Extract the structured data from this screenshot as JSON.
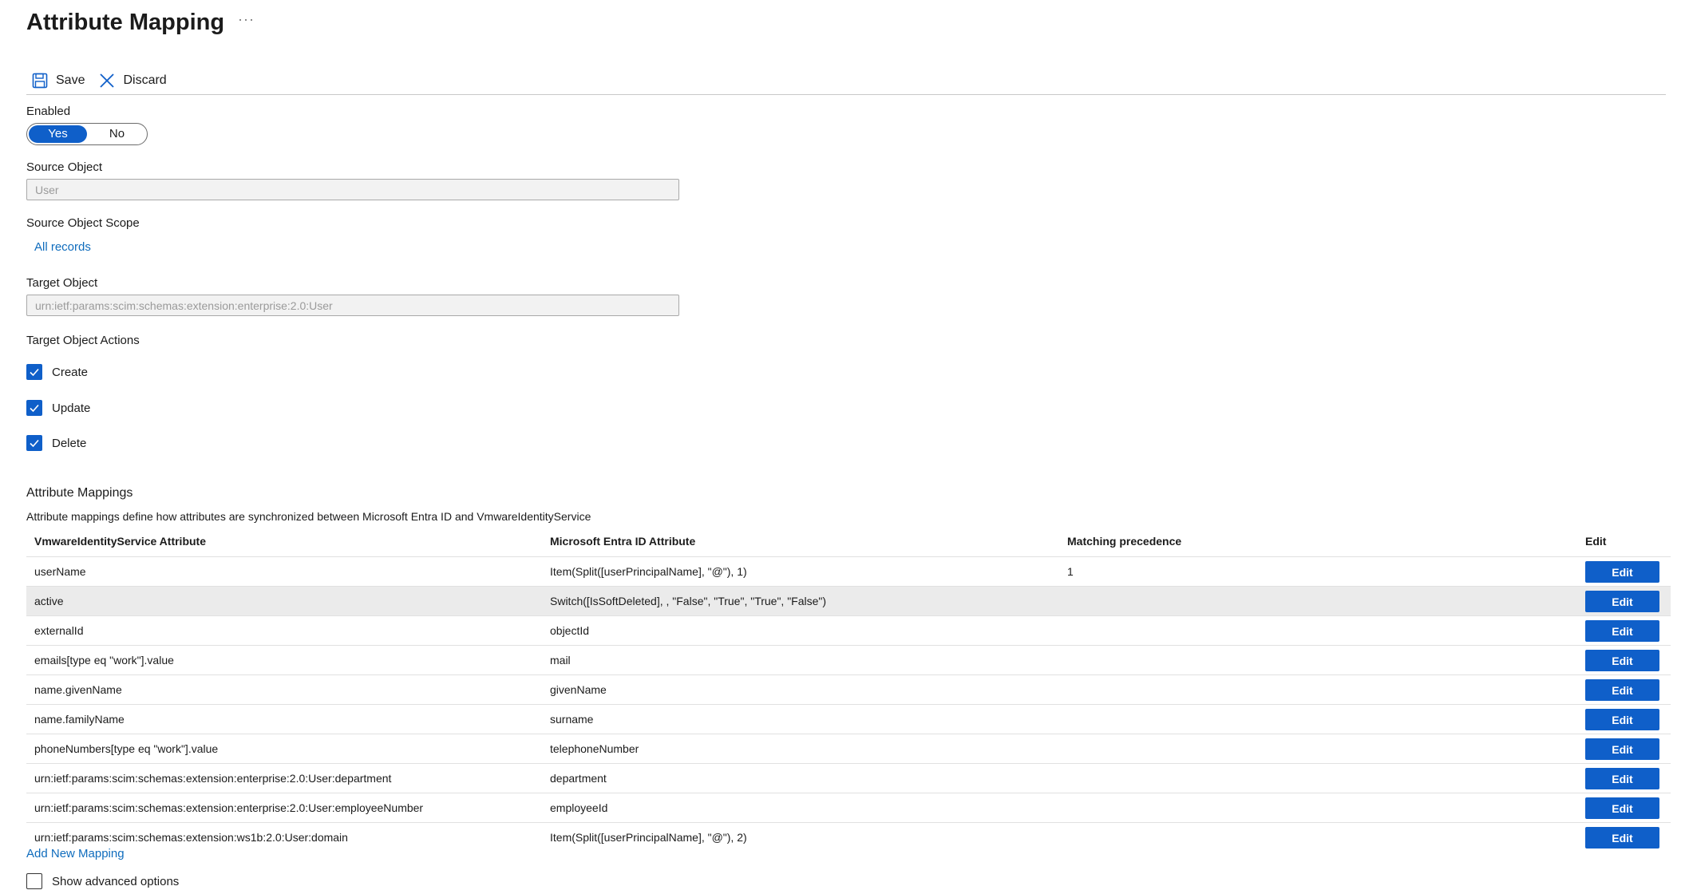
{
  "header": {
    "title": "Attribute Mapping",
    "more": "···"
  },
  "toolbar": {
    "save_label": "Save",
    "discard_label": "Discard"
  },
  "enabled": {
    "label": "Enabled",
    "yes": "Yes",
    "no": "No",
    "selected": "Yes"
  },
  "source_object": {
    "label": "Source Object",
    "value": "User"
  },
  "source_scope": {
    "label": "Source Object Scope",
    "link": "All records"
  },
  "target_object": {
    "label": "Target Object",
    "value": "urn:ietf:params:scim:schemas:extension:enterprise:2.0:User"
  },
  "target_actions": {
    "label": "Target Object Actions",
    "items": [
      {
        "label": "Create",
        "checked": true
      },
      {
        "label": "Update",
        "checked": true
      },
      {
        "label": "Delete",
        "checked": true
      }
    ]
  },
  "mappings": {
    "title": "Attribute Mappings",
    "description": "Attribute mappings define how attributes are synchronized between Microsoft Entra ID and VmwareIdentityService",
    "columns": [
      "VmwareIdentityService Attribute",
      "Microsoft Entra ID Attribute",
      "Matching precedence",
      "Edit"
    ],
    "edit_label": "Edit",
    "rows": [
      {
        "target": "userName",
        "source": "Item(Split([userPrincipalName], \"@\"), 1)",
        "precedence": "1"
      },
      {
        "target": "active",
        "source": "Switch([IsSoftDeleted], , \"False\", \"True\", \"True\", \"False\")",
        "precedence": ""
      },
      {
        "target": "externalId",
        "source": "objectId",
        "precedence": ""
      },
      {
        "target": "emails[type eq \"work\"].value",
        "source": "mail",
        "precedence": ""
      },
      {
        "target": "name.givenName",
        "source": "givenName",
        "precedence": ""
      },
      {
        "target": "name.familyName",
        "source": "surname",
        "precedence": ""
      },
      {
        "target": "phoneNumbers[type eq \"work\"].value",
        "source": "telephoneNumber",
        "precedence": ""
      },
      {
        "target": "urn:ietf:params:scim:schemas:extension:enterprise:2.0:User:department",
        "source": "department",
        "precedence": ""
      },
      {
        "target": "urn:ietf:params:scim:schemas:extension:enterprise:2.0:User:employeeNumber",
        "source": "employeeId",
        "precedence": ""
      },
      {
        "target": "urn:ietf:params:scim:schemas:extension:ws1b:2.0:User:domain",
        "source": "Item(Split([userPrincipalName], \"@\"), 2)",
        "precedence": ""
      }
    ],
    "add_link": "Add New Mapping"
  },
  "advanced": {
    "label": "Show advanced options",
    "checked": false
  },
  "colors": {
    "accent": "#0f5fc9",
    "link": "#0f6cbd",
    "row_highlight": "#ebebeb"
  },
  "icons": {
    "save": "save-icon",
    "discard": "close-icon",
    "check": "checkmark-icon"
  }
}
